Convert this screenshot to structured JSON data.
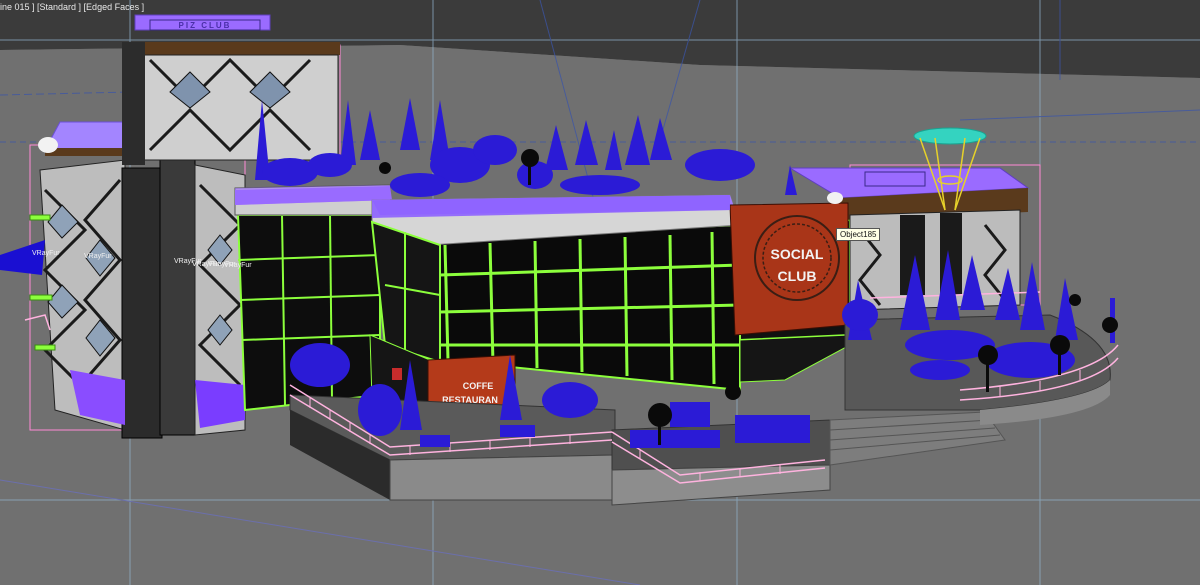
{
  "viewport": {
    "label": "ine 015 ] [Standard ] [Edged Faces ]"
  },
  "tooltip": {
    "object_name": "Object185"
  },
  "fur_labels": [
    "VRayFur",
    "VRayFur",
    "VRayFur",
    "VRayFur",
    "VRayFur",
    "VRayFur"
  ],
  "signs": {
    "social_club": [
      "SOCIAL",
      "CLUB"
    ],
    "restaurant": [
      "COFFE",
      "RESTAURAN"
    ],
    "top_sign": "PIZ  CLUB"
  },
  "colors": {
    "background": "#6b6b6b",
    "horizon": "#3d3d3d",
    "wire_green": "#8cff3c",
    "plant_blue": "#2b1bd6",
    "roof_purple": "#9a6bff",
    "sign_red": "#a93518",
    "rail_pink": "#ffb3df"
  }
}
